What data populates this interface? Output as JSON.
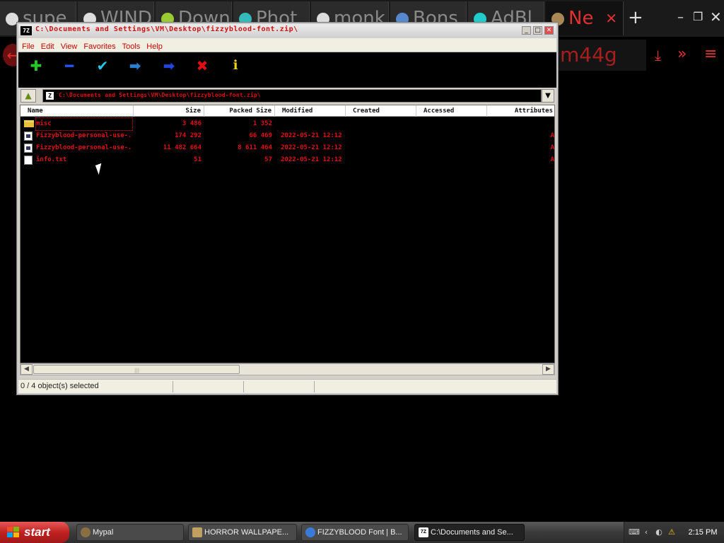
{
  "browser": {
    "tabs": [
      {
        "label": "supe"
      },
      {
        "label": "WIND"
      },
      {
        "label": "Down"
      },
      {
        "label": "Phot"
      },
      {
        "label": "monk"
      },
      {
        "label": "Bons"
      },
      {
        "label": "AdBl"
      },
      {
        "label": "Ne"
      }
    ],
    "address_fragment": "m44g"
  },
  "window": {
    "title": "C:\\Documents and Settings\\VM\\Desktop\\fizzyblood-font.zip\\",
    "icon_label": "7Z"
  },
  "menu": [
    "File",
    "Edit",
    "View",
    "Favorites",
    "Tools",
    "Help"
  ],
  "toolbar": {
    "add": "✚",
    "extract": "━",
    "test": "✔",
    "copy": "➡",
    "move": "➡",
    "delete": "✖",
    "info": "ℹ"
  },
  "path": {
    "icon_label": "Z",
    "value": "C:\\Documents and Settings\\VM\\Desktop\\fizzyblood-font.zip\\"
  },
  "columns": [
    "Name",
    "Size",
    "Packed Size",
    "Modified",
    "Created",
    "Accessed",
    "Attributes"
  ],
  "files": [
    {
      "name": "misc",
      "size": "3 486",
      "packed": "1 352",
      "modified": "",
      "attr": "",
      "icon": "folder-icon"
    },
    {
      "name": "Fizzyblood-personal-use-...",
      "size": "174 292",
      "packed": "66 469",
      "modified": "2022-05-21 12:12",
      "attr": "A",
      "icon": "font-file-icon"
    },
    {
      "name": "Fizzyblood-personal-use-...",
      "size": "11 482 664",
      "packed": "8 611 464",
      "modified": "2022-05-21 12:12",
      "attr": "A",
      "icon": "font-file-icon"
    },
    {
      "name": "info.txt",
      "size": "51",
      "packed": "57",
      "modified": "2022-05-21 12:12",
      "attr": "A",
      "icon": "text-file-icon"
    }
  ],
  "status": "0 / 4 object(s) selected",
  "taskbar": {
    "start": "start",
    "items": [
      {
        "label": "Mypal"
      },
      {
        "label": "HORROR WALLPAPE..."
      },
      {
        "label": "FIZZYBLOOD Font | B..."
      },
      {
        "label": "C:\\Documents and Se..."
      }
    ],
    "clock": "2:15 PM"
  }
}
